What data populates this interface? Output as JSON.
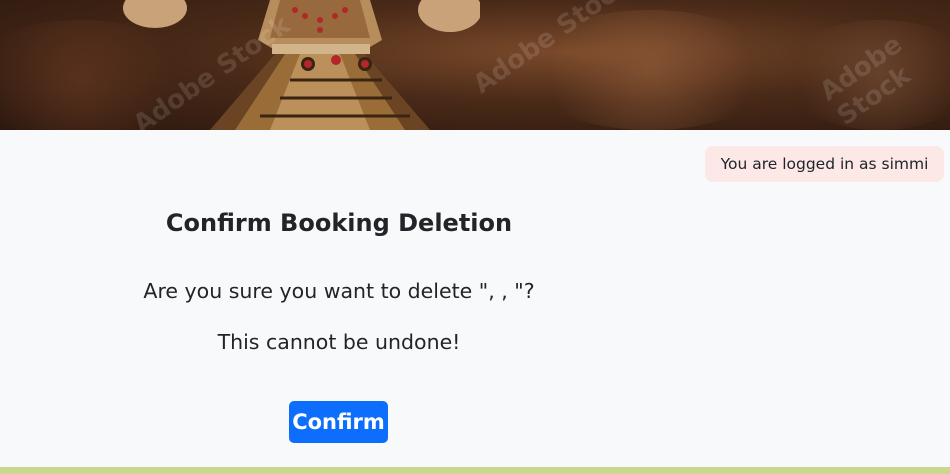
{
  "hero": {
    "watermark_text": "Adobe Stock",
    "colors": {
      "dark": "#2a170e",
      "mid": "#7a4a2a"
    }
  },
  "header": {
    "login_status": "You are logged in as simmi"
  },
  "dialog": {
    "title": "Confirm Booking Deletion",
    "question": "Are you sure you want to delete \", , \"?",
    "warning": "This cannot be undone!",
    "confirm_label": "Confirm"
  },
  "colors": {
    "primary": "#0d6efd",
    "badge_bg": "#fde8e8",
    "footer_bar": "#c9d88c",
    "page_bg": "#f8f9fb"
  }
}
